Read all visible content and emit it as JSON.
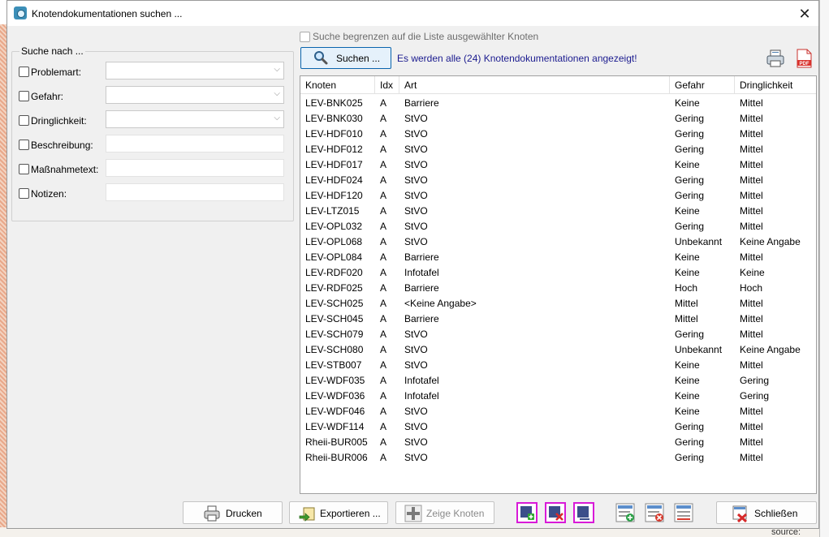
{
  "window": {
    "title": "Knotendokumentationen suchen ...",
    "close_glyph": "✕"
  },
  "search": {
    "group_title": "Suche nach ...",
    "criteria": [
      {
        "label": "Problemart:",
        "kind": "combo",
        "value": ""
      },
      {
        "label": "Gefahr:",
        "kind": "combo",
        "value": ""
      },
      {
        "label": "Dringlichkeit:",
        "kind": "combo",
        "value": ""
      },
      {
        "label": "Beschreibung:",
        "kind": "text",
        "value": ""
      },
      {
        "label": "Maßnahmetext:",
        "kind": "text",
        "value": ""
      },
      {
        "label": "Notizen:",
        "kind": "text",
        "value": ""
      }
    ],
    "limit_label": "Suche begrenzen auf die Liste ausgewählter Knoten",
    "search_button": "Suchen ...",
    "result_message": "Es werden alle (24) Knotendokumentationen angezeigt!"
  },
  "toolbar_icons": {
    "print": "printer-icon",
    "pdf": "pdf-icon",
    "pdf_text": "PDF"
  },
  "table": {
    "columns": [
      "Knoten",
      "Idx",
      "Art",
      "Gefahr",
      "Dringlichkeit"
    ],
    "rows": [
      [
        "LEV-BNK025",
        "A",
        "Barriere",
        "Keine",
        "Mittel"
      ],
      [
        "LEV-BNK030",
        "A",
        "StVO",
        "Gering",
        "Mittel"
      ],
      [
        "LEV-HDF010",
        "A",
        "StVO",
        "Gering",
        "Mittel"
      ],
      [
        "LEV-HDF012",
        "A",
        "StVO",
        "Gering",
        "Mittel"
      ],
      [
        "LEV-HDF017",
        "A",
        "StVO",
        "Keine",
        "Mittel"
      ],
      [
        "LEV-HDF024",
        "A",
        "StVO",
        "Gering",
        "Mittel"
      ],
      [
        "LEV-HDF120",
        "A",
        "StVO",
        "Gering",
        "Mittel"
      ],
      [
        "LEV-LTZ015",
        "A",
        "StVO",
        "Keine",
        "Mittel"
      ],
      [
        "LEV-OPL032",
        "A",
        "StVO",
        "Gering",
        "Mittel"
      ],
      [
        "LEV-OPL068",
        "A",
        "StVO",
        "Unbekannt",
        "Keine Angabe"
      ],
      [
        "LEV-OPL084",
        "A",
        "Barriere",
        "Keine",
        "Mittel"
      ],
      [
        "LEV-RDF020",
        "A",
        "Infotafel",
        "Keine",
        "Keine"
      ],
      [
        "LEV-RDF025",
        "A",
        "Barriere",
        "Hoch",
        "Hoch"
      ],
      [
        "LEV-SCH025",
        "A",
        "<Keine Angabe>",
        "Mittel",
        "Mittel"
      ],
      [
        "LEV-SCH045",
        "A",
        "Barriere",
        "Mittel",
        "Mittel"
      ],
      [
        "LEV-SCH079",
        "A",
        "StVO",
        "Gering",
        "Mittel"
      ],
      [
        "LEV-SCH080",
        "A",
        "StVO",
        "Unbekannt",
        "Keine Angabe"
      ],
      [
        "LEV-STB007",
        "A",
        "StVO",
        "Keine",
        "Mittel"
      ],
      [
        "LEV-WDF035",
        "A",
        "Infotafel",
        "Keine",
        "Gering"
      ],
      [
        "LEV-WDF036",
        "A",
        "Infotafel",
        "Keine",
        "Gering"
      ],
      [
        "LEV-WDF046",
        "A",
        "StVO",
        "Keine",
        "Mittel"
      ],
      [
        "LEV-WDF114",
        "A",
        "StVO",
        "Gering",
        "Mittel"
      ],
      [
        "Rheii-BUR005",
        "A",
        "StVO",
        "Gering",
        "Mittel"
      ],
      [
        "Rheii-BUR006",
        "A",
        "StVO",
        "Gering",
        "Mittel"
      ]
    ]
  },
  "buttons": {
    "print": "Drucken",
    "export": "Exportieren ...",
    "show_nodes": "Zeige Knoten",
    "close": "Schließen"
  },
  "background": {
    "bottom_right_text": "source:"
  },
  "colors": {
    "accent": "#0a64ad",
    "highlight_border": "#d81ad8",
    "message": "#1b1b8f"
  }
}
